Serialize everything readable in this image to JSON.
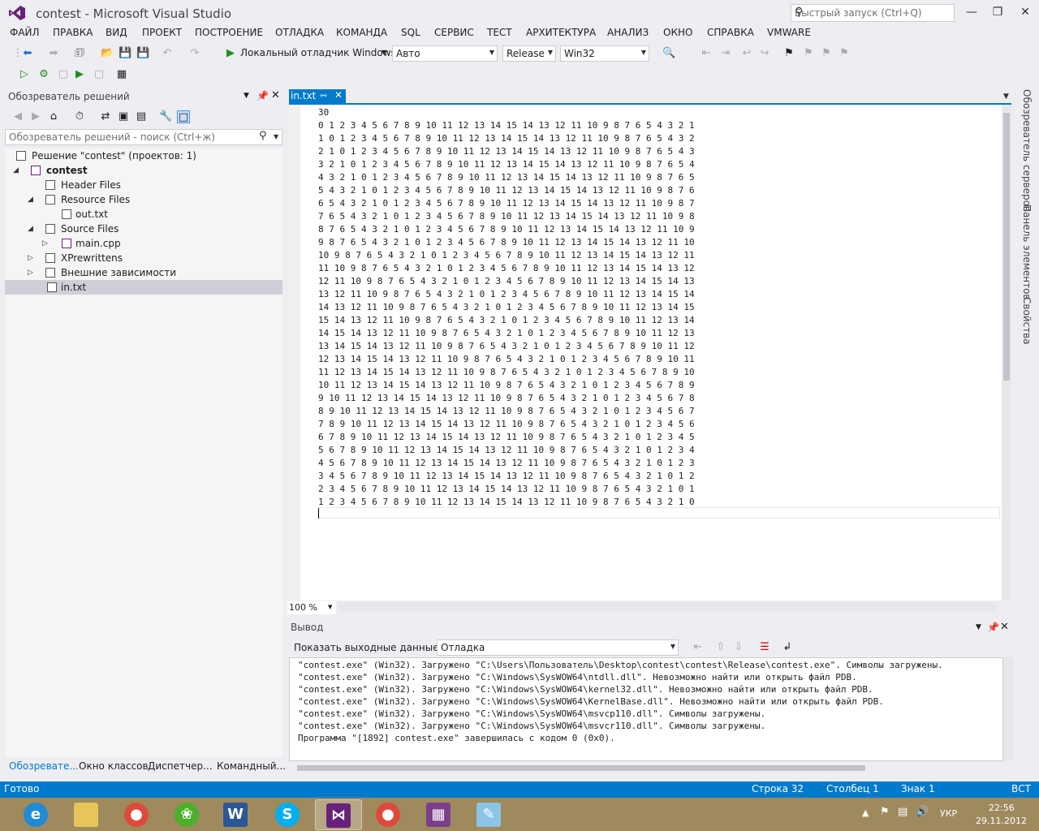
{
  "window": {
    "title": "contest - Microsoft Visual Studio",
    "quick_launch_placeholder": "Быстрый запуск (Ctrl+Q)"
  },
  "menu": [
    "ФАЙЛ",
    "ПРАВКА",
    "ВИД",
    "ПРОЕКТ",
    "ПОСТРОЕНИЕ",
    "ОТЛАДКА",
    "КОМАНДА",
    "SQL",
    "СЕРВИС",
    "ТЕСТ",
    "АРХИТЕКТУРА",
    "АНАЛИЗ",
    "ОКНО",
    "СПРАВКА",
    "VMWARE"
  ],
  "toolbar": {
    "debugger_label": "Локальный отладчик Windows",
    "config_auto": "Авто",
    "config_release": "Release",
    "platform": "Win32"
  },
  "solution_explorer": {
    "title": "Обозреватель решений",
    "search_placeholder": "Обозреватель решений - поиск (Ctrl+ж)",
    "tree": [
      {
        "label": "Решение \"contest\"  (проектов: 1)",
        "level": 0,
        "expander": "",
        "bold": false
      },
      {
        "label": "contest",
        "level": 0,
        "expander": "◢",
        "bold": true
      },
      {
        "label": "Header Files",
        "level": 2,
        "expander": "",
        "bold": false
      },
      {
        "label": "Resource Files",
        "level": 2,
        "expander": "◢",
        "bold": false
      },
      {
        "label": "out.txt",
        "level": 3,
        "expander": "",
        "bold": false
      },
      {
        "label": "Source Files",
        "level": 2,
        "expander": "◢",
        "bold": false
      },
      {
        "label": "main.cpp",
        "level": 3,
        "expander": "▷",
        "bold": false
      },
      {
        "label": "XPrewrittens",
        "level": 2,
        "expander": "▷",
        "bold": false
      },
      {
        "label": "Внешние зависимости",
        "level": 2,
        "expander": "▷",
        "bold": false
      },
      {
        "label": "in.txt",
        "level": 2,
        "expander": "",
        "bold": false
      }
    ],
    "bottom_tabs": [
      "Обозревате...",
      "Окно классов",
      "Диспетчер...",
      "Командный..."
    ]
  },
  "editor": {
    "tab_label": "in.txt",
    "zoom": "100 %",
    "lines": [
      "30",
      "0 1 2 3 4 5 6 7 8 9 10 11 12 13 14 15 14 13 12 11 10 9 8 7 6 5 4 3 2 1",
      "1 0 1 2 3 4 5 6 7 8 9 10 11 12 13 14 15 14 13 12 11 10 9 8 7 6 5 4 3 2",
      "2 1 0 1 2 3 4 5 6 7 8 9 10 11 12 13 14 15 14 13 12 11 10 9 8 7 6 5 4 3",
      "3 2 1 0 1 2 3 4 5 6 7 8 9 10 11 12 13 14 15 14 13 12 11 10 9 8 7 6 5 4",
      "4 3 2 1 0 1 2 3 4 5 6 7 8 9 10 11 12 13 14 15 14 13 12 11 10 9 8 7 6 5",
      "5 4 3 2 1 0 1 2 3 4 5 6 7 8 9 10 11 12 13 14 15 14 13 12 11 10 9 8 7 6",
      "6 5 4 3 2 1 0 1 2 3 4 5 6 7 8 9 10 11 12 13 14 15 14 13 12 11 10 9 8 7",
      "7 6 5 4 3 2 1 0 1 2 3 4 5 6 7 8 9 10 11 12 13 14 15 14 13 12 11 10 9 8",
      "8 7 6 5 4 3 2 1 0 1 2 3 4 5 6 7 8 9 10 11 12 13 14 15 14 13 12 11 10 9",
      "9 8 7 6 5 4 3 2 1 0 1 2 3 4 5 6 7 8 9 10 11 12 13 14 15 14 13 12 11 10",
      "10 9 8 7 6 5 4 3 2 1 0 1 2 3 4 5 6 7 8 9 10 11 12 13 14 15 14 13 12 11",
      "11 10 9 8 7 6 5 4 3 2 1 0 1 2 3 4 5 6 7 8 9 10 11 12 13 14 15 14 13 12",
      "12 11 10 9 8 7 6 5 4 3 2 1 0 1 2 3 4 5 6 7 8 9 10 11 12 13 14 15 14 13",
      "13 12 11 10 9 8 7 6 5 4 3 2 1 0 1 2 3 4 5 6 7 8 9 10 11 12 13 14 15 14",
      "14 13 12 11 10 9 8 7 6 5 4 3 2 1 0 1 2 3 4 5 6 7 8 9 10 11 12 13 14 15",
      "15 14 13 12 11 10 9 8 7 6 5 4 3 2 1 0 1 2 3 4 5 6 7 8 9 10 11 12 13 14",
      "14 15 14 13 12 11 10 9 8 7 6 5 4 3 2 1 0 1 2 3 4 5 6 7 8 9 10 11 12 13",
      "13 14 15 14 13 12 11 10 9 8 7 6 5 4 3 2 1 0 1 2 3 4 5 6 7 8 9 10 11 12",
      "12 13 14 15 14 13 12 11 10 9 8 7 6 5 4 3 2 1 0 1 2 3 4 5 6 7 8 9 10 11",
      "11 12 13 14 15 14 13 12 11 10 9 8 7 6 5 4 3 2 1 0 1 2 3 4 5 6 7 8 9 10",
      "10 11 12 13 14 15 14 13 12 11 10 9 8 7 6 5 4 3 2 1 0 1 2 3 4 5 6 7 8 9",
      "9 10 11 12 13 14 15 14 13 12 11 10 9 8 7 6 5 4 3 2 1 0 1 2 3 4 5 6 7 8",
      "8 9 10 11 12 13 14 15 14 13 12 11 10 9 8 7 6 5 4 3 2 1 0 1 2 3 4 5 6 7",
      "7 8 9 10 11 12 13 14 15 14 13 12 11 10 9 8 7 6 5 4 3 2 1 0 1 2 3 4 5 6",
      "6 7 8 9 10 11 12 13 14 15 14 13 12 11 10 9 8 7 6 5 4 3 2 1 0 1 2 3 4 5",
      "5 6 7 8 9 10 11 12 13 14 15 14 13 12 11 10 9 8 7 6 5 4 3 2 1 0 1 2 3 4",
      "4 5 6 7 8 9 10 11 12 13 14 15 14 13 12 11 10 9 8 7 6 5 4 3 2 1 0 1 2 3",
      "3 4 5 6 7 8 9 10 11 12 13 14 15 14 13 12 11 10 9 8 7 6 5 4 3 2 1 0 1 2",
      "2 3 4 5 6 7 8 9 10 11 12 13 14 15 14 13 12 11 10 9 8 7 6 5 4 3 2 1 0 1",
      "1 2 3 4 5 6 7 8 9 10 11 12 13 14 15 14 13 12 11 10 9 8 7 6 5 4 3 2 1 0"
    ]
  },
  "output": {
    "title": "Вывод",
    "show_label": "Показать выходные данные от:",
    "source": "Отладка",
    "lines": [
      "\"contest.exe\" (Win32). Загружено \"C:\\Users\\Пользователь\\Desktop\\contest\\contest\\Release\\contest.exe\". Символы загружены.",
      "\"contest.exe\" (Win32). Загружено \"C:\\Windows\\SysWOW64\\ntdll.dll\". Невозможно найти или открыть файл PDB.",
      "\"contest.exe\" (Win32). Загружено \"C:\\Windows\\SysWOW64\\kernel32.dll\". Невозможно найти или открыть файл PDB.",
      "\"contest.exe\" (Win32). Загружено \"C:\\Windows\\SysWOW64\\KernelBase.dll\". Невозможно найти или открыть файл PDB.",
      "\"contest.exe\" (Win32). Загружено \"C:\\Windows\\SysWOW64\\msvcp110.dll\". Символы загружены.",
      "\"contest.exe\" (Win32). Загружено \"C:\\Windows\\SysWOW64\\msvcr110.dll\". Символы загружены.",
      "Программа \"[1892] contest.exe\" завершилась с кодом 0 (0x0)."
    ]
  },
  "side_tabs": [
    "Обозреватель серверов",
    "Панель элементов",
    "Свойства"
  ],
  "statusbar": {
    "ready": "Готово",
    "line": "Строка 32",
    "column": "Столбец 1",
    "char": "Знак 1",
    "mode": "ВСТ"
  },
  "taskbar": {
    "lang": "УКР",
    "time": "22:56",
    "date": "29.11.2012"
  },
  "colors": {
    "accent": "#007acc",
    "vs_purple": "#68217a",
    "taskbar": "#9f8a5e"
  }
}
